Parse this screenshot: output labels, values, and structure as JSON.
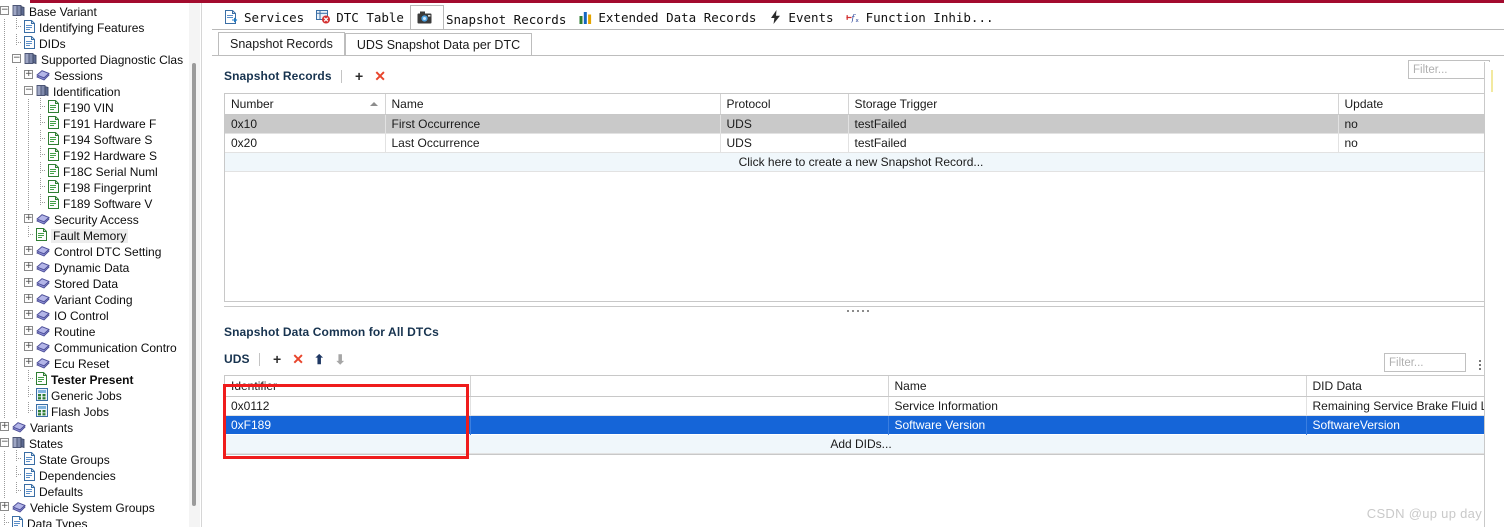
{
  "window": {
    "accent_color": "#a30b2e",
    "watermark": "CSDN @up up day"
  },
  "tree": {
    "items": [
      {
        "label": "Base Variant",
        "depth": 0,
        "icon": "module-icon",
        "expander": "minus",
        "bold": false,
        "selected": false
      },
      {
        "label": "Identifying Features",
        "depth": 1,
        "icon": "document-icon",
        "expander": "none",
        "bold": false,
        "selected": false
      },
      {
        "label": "DIDs",
        "depth": 1,
        "icon": "document-icon",
        "expander": "none",
        "bold": false,
        "selected": false
      },
      {
        "label": "Supported Diagnostic Clas",
        "depth": 1,
        "icon": "module-icon",
        "expander": "minus",
        "bold": false,
        "selected": false
      },
      {
        "label": "Sessions",
        "depth": 2,
        "icon": "book-icon",
        "expander": "plus",
        "bold": false,
        "selected": false
      },
      {
        "label": "Identification",
        "depth": 2,
        "icon": "module-icon",
        "expander": "minus",
        "bold": false,
        "selected": false
      },
      {
        "label": "F190 VIN",
        "depth": 3,
        "icon": "greendoc-icon",
        "expander": "none",
        "bold": false,
        "selected": false
      },
      {
        "label": "F191 Hardware F",
        "depth": 3,
        "icon": "greendoc-icon",
        "expander": "none",
        "bold": false,
        "selected": false
      },
      {
        "label": "F194 Software S",
        "depth": 3,
        "icon": "greendoc-icon",
        "expander": "none",
        "bold": false,
        "selected": false
      },
      {
        "label": "F192 Hardware S",
        "depth": 3,
        "icon": "greendoc-icon",
        "expander": "none",
        "bold": false,
        "selected": false
      },
      {
        "label": "F18C Serial Numl",
        "depth": 3,
        "icon": "greendoc-icon",
        "expander": "none",
        "bold": false,
        "selected": false
      },
      {
        "label": "F198 Fingerprint",
        "depth": 3,
        "icon": "greendoc-icon",
        "expander": "none",
        "bold": false,
        "selected": false
      },
      {
        "label": "F189 Software V",
        "depth": 3,
        "icon": "greendoc-icon",
        "expander": "none",
        "bold": false,
        "selected": false
      },
      {
        "label": "Security Access",
        "depth": 2,
        "icon": "book-icon",
        "expander": "plus",
        "bold": false,
        "selected": false
      },
      {
        "label": "Fault Memory",
        "depth": 2,
        "icon": "greendoc-icon",
        "expander": "none",
        "bold": false,
        "selected": true
      },
      {
        "label": "Control DTC Setting",
        "depth": 2,
        "icon": "book-icon",
        "expander": "plus",
        "bold": false,
        "selected": false
      },
      {
        "label": "Dynamic Data",
        "depth": 2,
        "icon": "book-icon",
        "expander": "plus",
        "bold": false,
        "selected": false
      },
      {
        "label": "Stored Data",
        "depth": 2,
        "icon": "book-icon",
        "expander": "plus",
        "bold": false,
        "selected": false
      },
      {
        "label": "Variant Coding",
        "depth": 2,
        "icon": "book-icon",
        "expander": "plus",
        "bold": false,
        "selected": false
      },
      {
        "label": "IO Control",
        "depth": 2,
        "icon": "book-icon",
        "expander": "plus",
        "bold": false,
        "selected": false
      },
      {
        "label": "Routine",
        "depth": 2,
        "icon": "book-icon",
        "expander": "plus",
        "bold": false,
        "selected": false
      },
      {
        "label": "Communication Contro",
        "depth": 2,
        "icon": "book-icon",
        "expander": "plus",
        "bold": false,
        "selected": false
      },
      {
        "label": "Ecu Reset",
        "depth": 2,
        "icon": "book-icon",
        "expander": "plus",
        "bold": false,
        "selected": false
      },
      {
        "label": "Tester Present",
        "depth": 2,
        "icon": "greendoc-icon",
        "expander": "none",
        "bold": true,
        "selected": false
      },
      {
        "label": "Generic Jobs",
        "depth": 2,
        "icon": "job-icon",
        "expander": "none",
        "bold": false,
        "selected": false
      },
      {
        "label": "Flash Jobs",
        "depth": 2,
        "icon": "job-icon",
        "expander": "none",
        "bold": false,
        "selected": false
      },
      {
        "label": "Variants",
        "depth": 0,
        "icon": "book-icon",
        "expander": "plus",
        "bold": false,
        "selected": false
      },
      {
        "label": "States",
        "depth": 0,
        "icon": "module-icon",
        "expander": "minus",
        "bold": false,
        "selected": false
      },
      {
        "label": "State Groups",
        "depth": 1,
        "icon": "document-icon",
        "expander": "none",
        "bold": false,
        "selected": false
      },
      {
        "label": "Dependencies",
        "depth": 1,
        "icon": "document-icon",
        "expander": "none",
        "bold": false,
        "selected": false
      },
      {
        "label": "Defaults",
        "depth": 1,
        "icon": "document-icon",
        "expander": "none",
        "bold": false,
        "selected": false
      },
      {
        "label": "Vehicle System Groups",
        "depth": 0,
        "icon": "book-icon",
        "expander": "plus",
        "bold": false,
        "selected": false
      },
      {
        "label": "Data Types",
        "depth": 0,
        "icon": "document-icon",
        "expander": "none",
        "bold": false,
        "selected": false
      }
    ]
  },
  "command_bar": {
    "items": [
      {
        "label": "Services",
        "icon": "services-icon",
        "active": false
      },
      {
        "label": "DTC Table",
        "icon": "dtc-table-icon",
        "active": false
      },
      {
        "label": "Snapshot Records",
        "icon": "camera-icon",
        "active": true
      },
      {
        "label": "Extended Data Records",
        "icon": "bar-chart-icon",
        "active": false
      },
      {
        "label": "Events",
        "icon": "lightning-icon",
        "active": false
      },
      {
        "label": "Function Inhib...",
        "icon": "function-inhibit-icon",
        "active": false
      }
    ]
  },
  "tabs": [
    {
      "label": "Snapshot Records",
      "active": true
    },
    {
      "label": "UDS Snapshot Data per DTC",
      "active": false
    }
  ],
  "snapshot_records": {
    "title": "Snapshot Records",
    "add_label": "+",
    "delete_label": "✕",
    "filter_placeholder": "Filter...",
    "filter_value": "",
    "search_icon": "search-icon",
    "columns": [
      "Number",
      "Name",
      "Protocol",
      "Storage Trigger",
      "Update"
    ],
    "sorted_column": "Number",
    "sort_direction": "ascending",
    "rows": [
      {
        "number": "0x10",
        "name": "First Occurrence",
        "protocol": "UDS",
        "storage_trigger": "testFailed",
        "update": "no",
        "selected": true
      },
      {
        "number": "0x20",
        "name": "Last Occurrence",
        "protocol": "UDS",
        "storage_trigger": "testFailed",
        "update": "no",
        "selected": false
      }
    ],
    "new_row_hint": "Click here to create a new Snapshot Record..."
  },
  "snapshot_common": {
    "title": "Snapshot Data Common for All DTCs",
    "protocol_label": "UDS",
    "add_label": "+",
    "delete_label": "✕",
    "move_up_label": "⬆",
    "move_down_label": "⬇",
    "filter_placeholder": "Filter...",
    "filter_value": "",
    "search_icon": "search-icon",
    "more_icon": "kebab-menu-icon",
    "columns": [
      "Identifier",
      "",
      "Name",
      "DID Data"
    ],
    "rows": [
      {
        "identifier": "0x0112",
        "blank": "",
        "name": "Service Information",
        "did_data": "Remaining Service Brake Fluid Life, Remaining Service Time Left",
        "selected": false
      },
      {
        "identifier": "0xF189",
        "blank": "",
        "name": "Software Version",
        "did_data": "SoftwareVersion",
        "selected": true
      }
    ],
    "new_row_hint": "Add DIDs..."
  }
}
